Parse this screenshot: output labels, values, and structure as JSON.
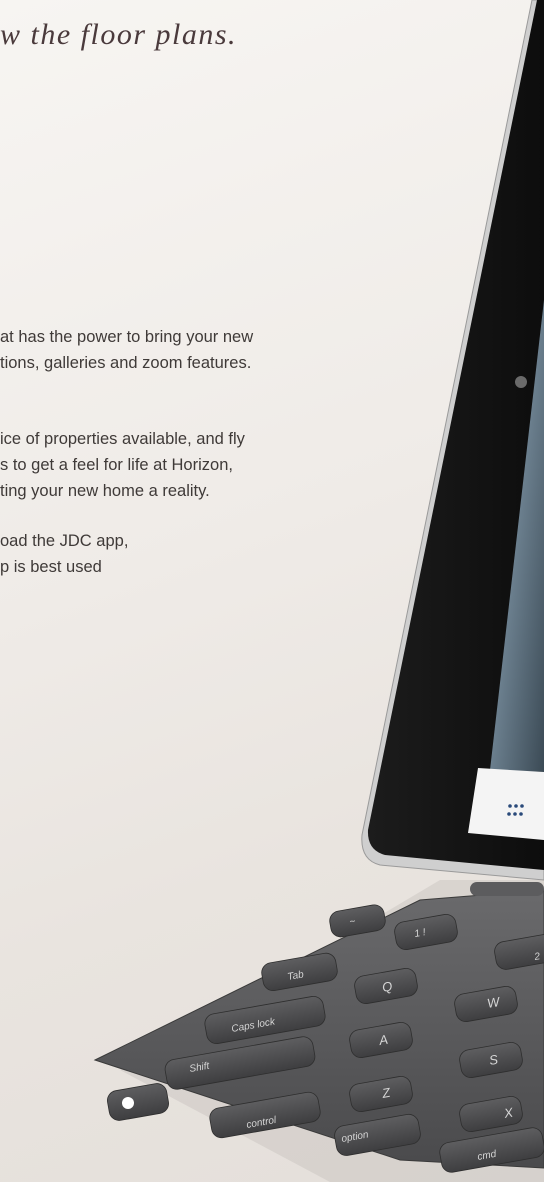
{
  "heading": "w the floor plans.",
  "paragraphs": [
    {
      "lines": [
        "at has the power to bring your new",
        "tions, galleries and zoom features."
      ]
    },
    {
      "lines": [
        "ice of properties available, and fly",
        "s to get a feel for life at Horizon,",
        "ting your new home a reality."
      ]
    },
    {
      "lines": [
        "oad the JDC app,",
        "p is best used"
      ]
    }
  ],
  "keyboard": {
    "keys": [
      "~",
      "1 !",
      "2",
      "Tab",
      "Q",
      "W",
      "Caps lock",
      "A",
      "S",
      "Shift",
      "Z",
      "X",
      "control",
      "option",
      "cmd"
    ]
  },
  "ipad_toolbar": {
    "icon": "grid-dots-icon"
  },
  "colors": {
    "background": "#efebe7",
    "heading": "#4a3a3c",
    "text": "#3f3a38",
    "ipad_bezel": "#151515",
    "keyboard": "#58585a"
  }
}
